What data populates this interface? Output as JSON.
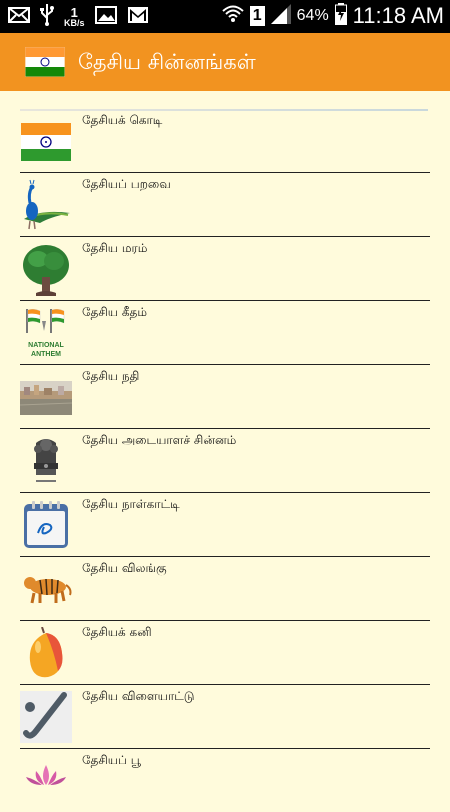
{
  "status_bar": {
    "net_speed_value": "1",
    "net_speed_unit": "KB/s",
    "sim_badge": "1",
    "battery_percent": "64%",
    "time": "11:18 AM"
  },
  "action_bar": {
    "title": "தேசிய சின்னங்கள்",
    "background_color": "#f29320"
  },
  "list": {
    "items": [
      {
        "label": "தேசியக் கொடி",
        "icon": "indian-flag-icon"
      },
      {
        "label": "தேசியப் பறவை",
        "icon": "peacock-icon"
      },
      {
        "label": "தேசிய மரம்",
        "icon": "banyan-tree-icon"
      },
      {
        "label": "தேசிய கீதம்",
        "icon": "national-anthem-icon",
        "icon_text": "NATIONAL ANTHEM"
      },
      {
        "label": "தேசிய நதி",
        "icon": "river-ganga-icon"
      },
      {
        "label": "தேசிய அடையாளச் சின்னம்",
        "icon": "state-emblem-icon"
      },
      {
        "label": "தேசிய நாள்காட்டி",
        "icon": "calendar-icon"
      },
      {
        "label": "தேசிய விலங்கு",
        "icon": "tiger-icon"
      },
      {
        "label": "தேசியக் கனி",
        "icon": "mango-icon"
      },
      {
        "label": "தேசிய விளையாட்டு",
        "icon": "hockey-icon"
      },
      {
        "label": "தேசியப் பூ",
        "icon": "lotus-icon"
      }
    ]
  }
}
